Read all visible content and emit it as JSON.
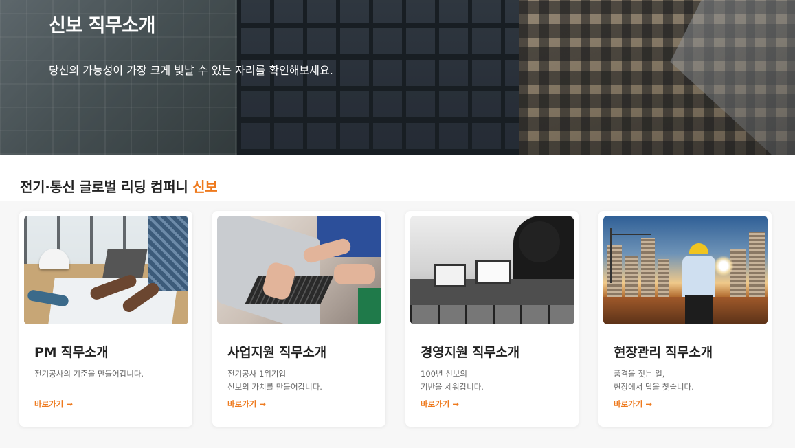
{
  "hero": {
    "title": "신보 직무소개",
    "subtitle": "당신의 가능성이 가장 크게 빛날 수 있는 자리를 확인해보세요."
  },
  "section": {
    "title_main": "전기·통신 글로벌 리딩 컴퍼니 ",
    "title_accent": "신보",
    "accent_color": "#ee7a1e"
  },
  "cards": [
    {
      "title": "PM 직무소개",
      "desc_lines": [
        "전기공사의 기준을 만들어갑니다.",
        ""
      ],
      "link": "바로가기 →"
    },
    {
      "title": "사업지원 직무소개",
      "desc_lines": [
        "전기공사 1위기업",
        "신보의 가치를 만들어갑니다."
      ],
      "link": "바로가기 →"
    },
    {
      "title": "경영지원 직무소개",
      "desc_lines": [
        "100년 신보의",
        "기반을 세워갑니다."
      ],
      "link": "바로가기 →"
    },
    {
      "title": "현장관리 직무소개",
      "desc_lines": [
        "품격을 짓는 일,",
        "현장에서 답을 찾습니다."
      ],
      "link": "바로가기 →"
    }
  ]
}
